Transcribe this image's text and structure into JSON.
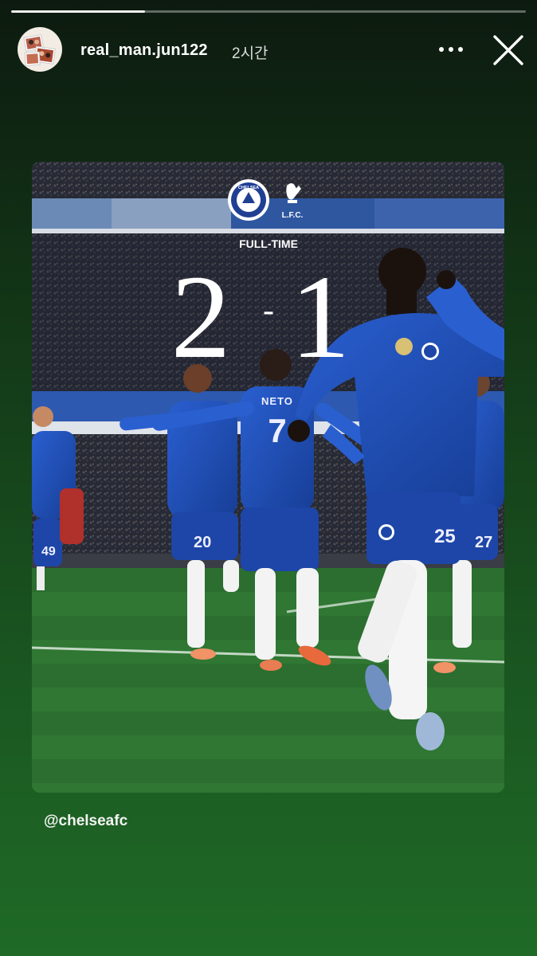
{
  "story": {
    "progress": 0.26,
    "username": "real_man.jun122",
    "time_ago": "2시간",
    "more_icon": "more-horizontal-icon",
    "close_icon": "close-icon"
  },
  "post": {
    "mention": "@chelseafc",
    "result_label": "FULL-TIME",
    "home_score": "2",
    "away_score": "1",
    "score_separator": "-",
    "home_crest_text": "CHELSEA",
    "away_crest_text": "L.F.C.",
    "player_shirt_name": "NETO",
    "player_shirt_number": "7",
    "colors": {
      "chelsea_blue": "#1f4fb5",
      "pitch_green": "#2f7a2f",
      "story_bg": "#1b5a22"
    }
  }
}
